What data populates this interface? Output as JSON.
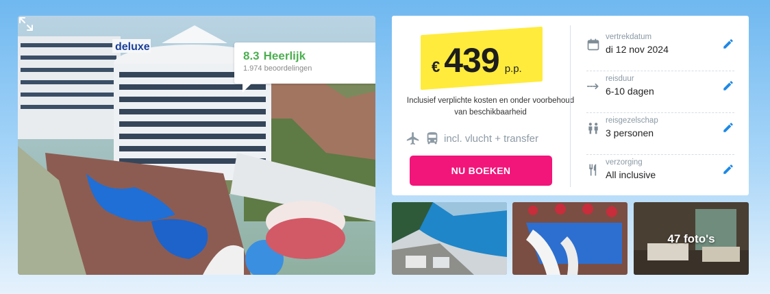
{
  "hotel_photo": {
    "alt": "Hotel Deluxe",
    "sign_text": "deluxe"
  },
  "rating": {
    "score": "8.3",
    "label": "Heerlijk",
    "reviews": "1.974 beoordelingen"
  },
  "price": {
    "currency": "€",
    "amount": "439",
    "unit": "p.p.",
    "note": "Inclusief verplichte kosten en onder voorbehoud van beschikbaarheid",
    "includes": "incl. vlucht + transfer",
    "highlight_color": "#ffeb3b"
  },
  "book_button": {
    "label": "NU BOEKEN",
    "color": "#f2157a"
  },
  "details": [
    {
      "label": "vertrekdatum",
      "value": "di 12 nov 2024",
      "icon": "calendar-icon"
    },
    {
      "label": "reisduur",
      "value": "6-10 dagen",
      "icon": "duration-arrow-icon"
    },
    {
      "label": "reisgezelschap",
      "value": "3 personen",
      "icon": "people-icon"
    },
    {
      "label": "verzorging",
      "value": "All inclusive",
      "icon": "cutlery-icon"
    }
  ],
  "edit_color": "#1e88e5",
  "gallery": {
    "count_label": "47 foto's"
  }
}
